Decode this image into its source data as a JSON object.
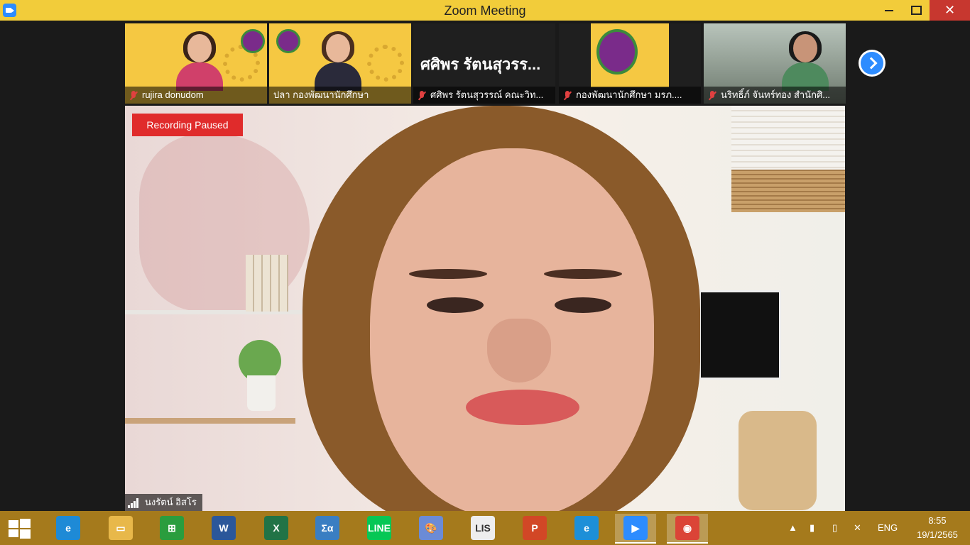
{
  "window": {
    "title": "Zoom Meeting",
    "minimize_icon": "minimize-icon",
    "maximize_icon": "maximize-icon",
    "close_glyph": "✕"
  },
  "participants": [
    {
      "name": "rujira donudom",
      "muted": true
    },
    {
      "name": "ปลา กองพัฒนานักศึกษา",
      "muted": false
    },
    {
      "name": "ศศิพร รัตนสุวรรณ์ คณะวิท...",
      "muted": true,
      "display_text": "ศศิพร รัตนสุวรร..."
    },
    {
      "name": "กองพัฒนานักศึกษา มรภ....",
      "muted": true
    },
    {
      "name": "นริทธิ์ภ์ จันทร์ทอง สำนักศิ...",
      "muted": true
    }
  ],
  "main_video": {
    "recording_status": "Recording Paused",
    "speaker_name": "นงรัตน์ อิสโร"
  },
  "taskbar": {
    "apps": [
      {
        "name": "internet-explorer",
        "glyph": "e",
        "color": "#1e8ad6"
      },
      {
        "name": "file-explorer",
        "glyph": "▭",
        "color": "#e8b84a"
      },
      {
        "name": "store",
        "glyph": "⊞",
        "color": "#2a9d3e"
      },
      {
        "name": "word",
        "glyph": "W",
        "color": "#2b579a"
      },
      {
        "name": "excel",
        "glyph": "X",
        "color": "#217346"
      },
      {
        "name": "math-input",
        "glyph": "Σα",
        "color": "#3a7ec2"
      },
      {
        "name": "line",
        "glyph": "LINE",
        "color": "#06c755"
      },
      {
        "name": "paint",
        "glyph": "🎨",
        "color": "#6b8bd6"
      },
      {
        "name": "lisrel",
        "glyph": "LIS",
        "color": "#eeeeee"
      },
      {
        "name": "powerpoint",
        "glyph": "P",
        "color": "#d24726"
      },
      {
        "name": "edge",
        "glyph": "e",
        "color": "#1d8fd8"
      },
      {
        "name": "zoom",
        "glyph": "▶",
        "color": "#2d8cff"
      },
      {
        "name": "chrome",
        "glyph": "◉",
        "color": "#db4437"
      }
    ],
    "tray": {
      "language": "ENG",
      "time": "8:55",
      "date": "19/1/2565"
    }
  }
}
